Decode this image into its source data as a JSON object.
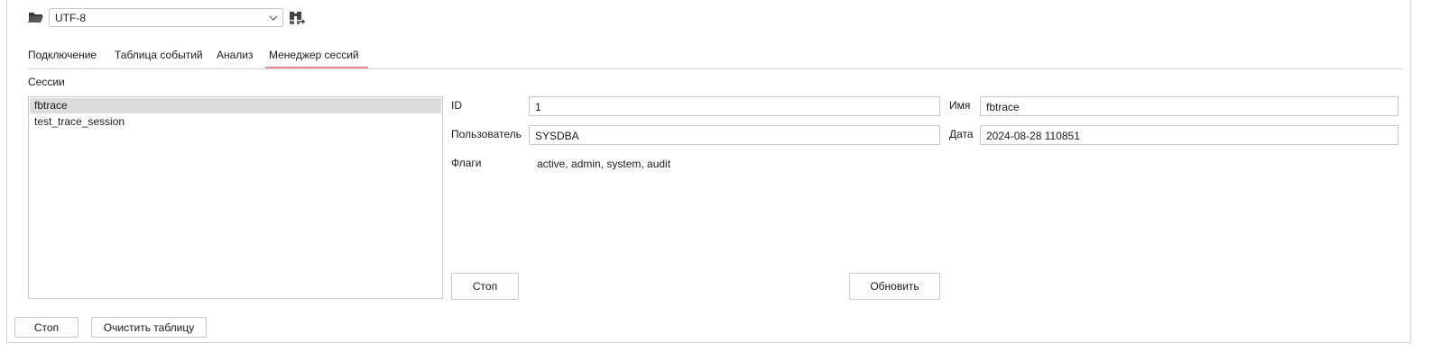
{
  "toolbar": {
    "encoding": "UTF-8",
    "folder_icon": "folder-open-icon",
    "convert_icon": "binoculars-export-icon"
  },
  "tabs": [
    {
      "label": "Подключение",
      "active": false
    },
    {
      "label": "Таблица событий",
      "active": false
    },
    {
      "label": "Анализ",
      "active": false
    },
    {
      "label": "Менеджер сессий",
      "active": true
    }
  ],
  "sessions": {
    "label": "Сессии",
    "items": [
      "fbtrace",
      "test_trace_session"
    ],
    "selected": "fbtrace"
  },
  "details": {
    "id_label": "ID",
    "id_value": "1",
    "name_label": "Имя",
    "name_value": "fbtrace",
    "user_label": "Пользователь",
    "user_value": "SYSDBA",
    "date_label": "Дата",
    "date_value": "2024-08-28 110851",
    "flags_label": "Флаги",
    "flags_value": "active, admin, system, audit",
    "stop_label": "Стоп",
    "refresh_label": "Обновить"
  },
  "footer": {
    "stop_label": "Стоп",
    "clear_label": "Очистить таблицу"
  },
  "colors": {
    "tab_active_underline": "#e88a8f",
    "selected_row": "#dcdcdc"
  }
}
